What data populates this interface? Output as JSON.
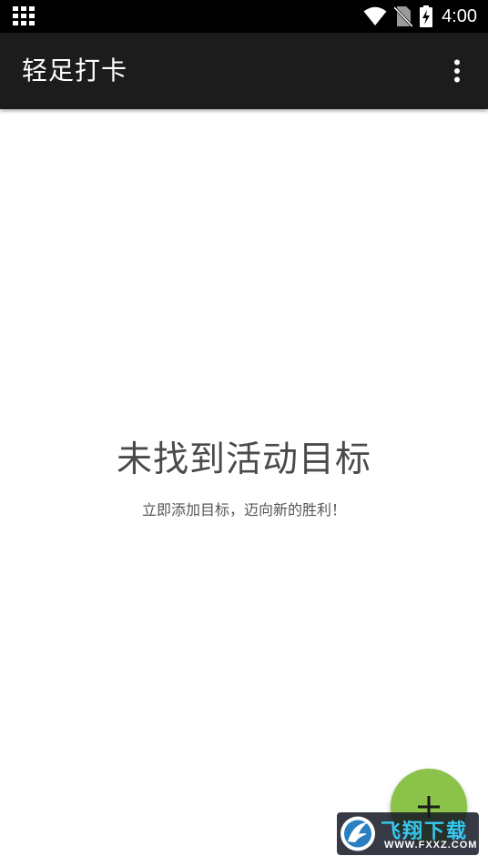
{
  "status_bar": {
    "time": "4:00",
    "icons": [
      "app-grid-icon",
      "wifi-icon",
      "no-sim-icon",
      "battery-charging-icon"
    ]
  },
  "app_bar": {
    "title": "轻足打卡",
    "overflow_icon": "more-vert-icon"
  },
  "empty_state": {
    "title": "未找到活动目标",
    "subtitle": "立即添加目标，迈向新的胜利！"
  },
  "fab": {
    "icon": "plus-icon",
    "color": "#8bc34a"
  },
  "watermark": {
    "text": "飞翔下载",
    "url": "WWW.FXXZ.COM"
  },
  "colors": {
    "app_bar": "#1c1c1c",
    "status_bar": "#000000",
    "accent": "#8bc34a"
  }
}
